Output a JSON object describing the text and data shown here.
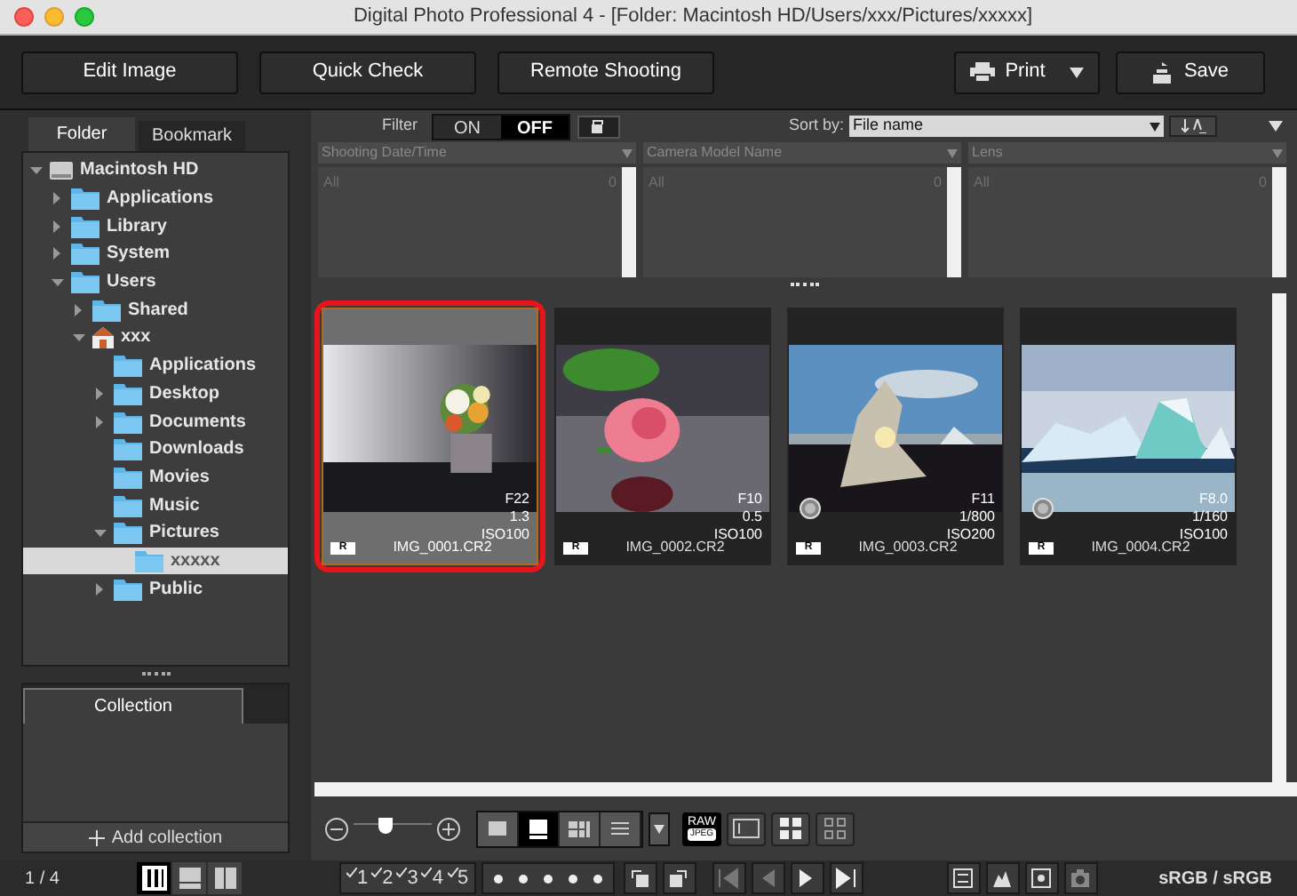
{
  "window": {
    "title": "Digital Photo Professional 4 - [Folder: Macintosh HD/Users/xxx/Pictures/xxxxx]"
  },
  "toolbar": {
    "buttons": [
      "Edit Image",
      "Quick Check",
      "Remote Shooting"
    ],
    "print": "Print",
    "save": "Save"
  },
  "sidebar": {
    "tabs": [
      {
        "label": "Folder",
        "selected": true
      },
      {
        "label": "Bookmark",
        "selected": false
      }
    ],
    "tree": [
      {
        "label": "Macintosh HD",
        "kind": "disk",
        "expanded": true,
        "selected": false,
        "children": [
          {
            "label": "Applications",
            "kind": "folder",
            "expanded": false,
            "selected": false
          },
          {
            "label": "Library",
            "kind": "folder",
            "expanded": false,
            "selected": false
          },
          {
            "label": "System",
            "kind": "folder",
            "expanded": false,
            "selected": false
          },
          {
            "label": "Users",
            "kind": "folder",
            "expanded": true,
            "selected": false,
            "children": [
              {
                "label": "Shared",
                "kind": "folder",
                "expanded": false,
                "selected": false
              },
              {
                "label": "xxx",
                "kind": "home",
                "expanded": true,
                "selected": false,
                "children": [
                  {
                    "label": "Applications",
                    "kind": "folder",
                    "selected": false
                  },
                  {
                    "label": "Desktop",
                    "kind": "folder",
                    "expanded": false,
                    "selected": false
                  },
                  {
                    "label": "Documents",
                    "kind": "folder",
                    "expanded": false,
                    "selected": false
                  },
                  {
                    "label": "Downloads",
                    "kind": "folder",
                    "selected": false
                  },
                  {
                    "label": "Movies",
                    "kind": "folder",
                    "selected": false
                  },
                  {
                    "label": "Music",
                    "kind": "folder",
                    "selected": false
                  },
                  {
                    "label": "Pictures",
                    "kind": "folder",
                    "expanded": true,
                    "selected": false,
                    "children": [
                      {
                        "label": "xxxxx",
                        "kind": "folder",
                        "selected": true
                      }
                    ]
                  },
                  {
                    "label": "Public",
                    "kind": "folder",
                    "expanded": false,
                    "selected": false
                  }
                ]
              }
            ]
          }
        ]
      }
    ],
    "collection": {
      "tab": "Collection",
      "add": "Add collection"
    }
  },
  "filter": {
    "label": "Filter",
    "options": [
      {
        "label": "ON",
        "selected": false
      },
      {
        "label": "OFF",
        "selected": true
      }
    ],
    "locked": false,
    "sort_label": "Sort by:",
    "sort_value": "File name",
    "columns": [
      {
        "header": "Shooting Date/Time",
        "all": "All",
        "count": "0"
      },
      {
        "header": "Camera Model Name",
        "all": "All",
        "count": "0"
      },
      {
        "header": "Lens",
        "all": "All",
        "count": "0"
      }
    ]
  },
  "thumbnails": [
    {
      "filename": "IMG_0001.CR2",
      "aperture": "F22",
      "shutter": "1.3",
      "iso": "ISO100",
      "badge": "R",
      "selected": true,
      "edited": false
    },
    {
      "filename": "IMG_0002.CR2",
      "aperture": "F10",
      "shutter": "0.5",
      "iso": "ISO100",
      "badge": "R",
      "selected": false,
      "edited": false
    },
    {
      "filename": "IMG_0003.CR2",
      "aperture": "F11",
      "shutter": "1/800",
      "iso": "ISO200",
      "badge": "R",
      "selected": false,
      "edited": true
    },
    {
      "filename": "IMG_0004.CR2",
      "aperture": "F8.0",
      "shutter": "1/160",
      "iso": "ISO100",
      "badge": "R",
      "selected": false,
      "edited": true
    }
  ],
  "view_bar": {
    "zoom": {
      "level": 0.4
    },
    "modes": [
      {
        "selected": false
      },
      {
        "selected": true
      },
      {
        "selected": false
      },
      {
        "selected": false
      }
    ],
    "raw": "RAW",
    "jpeg": "JPEG"
  },
  "status_bar": {
    "count": "1 / 4",
    "layouts": [
      {
        "selected": true
      },
      {
        "selected": false
      },
      {
        "selected": false
      }
    ],
    "ratings": [
      "1",
      "2",
      "3",
      "4",
      "5"
    ],
    "color_space": "sRGB / sRGB"
  }
}
